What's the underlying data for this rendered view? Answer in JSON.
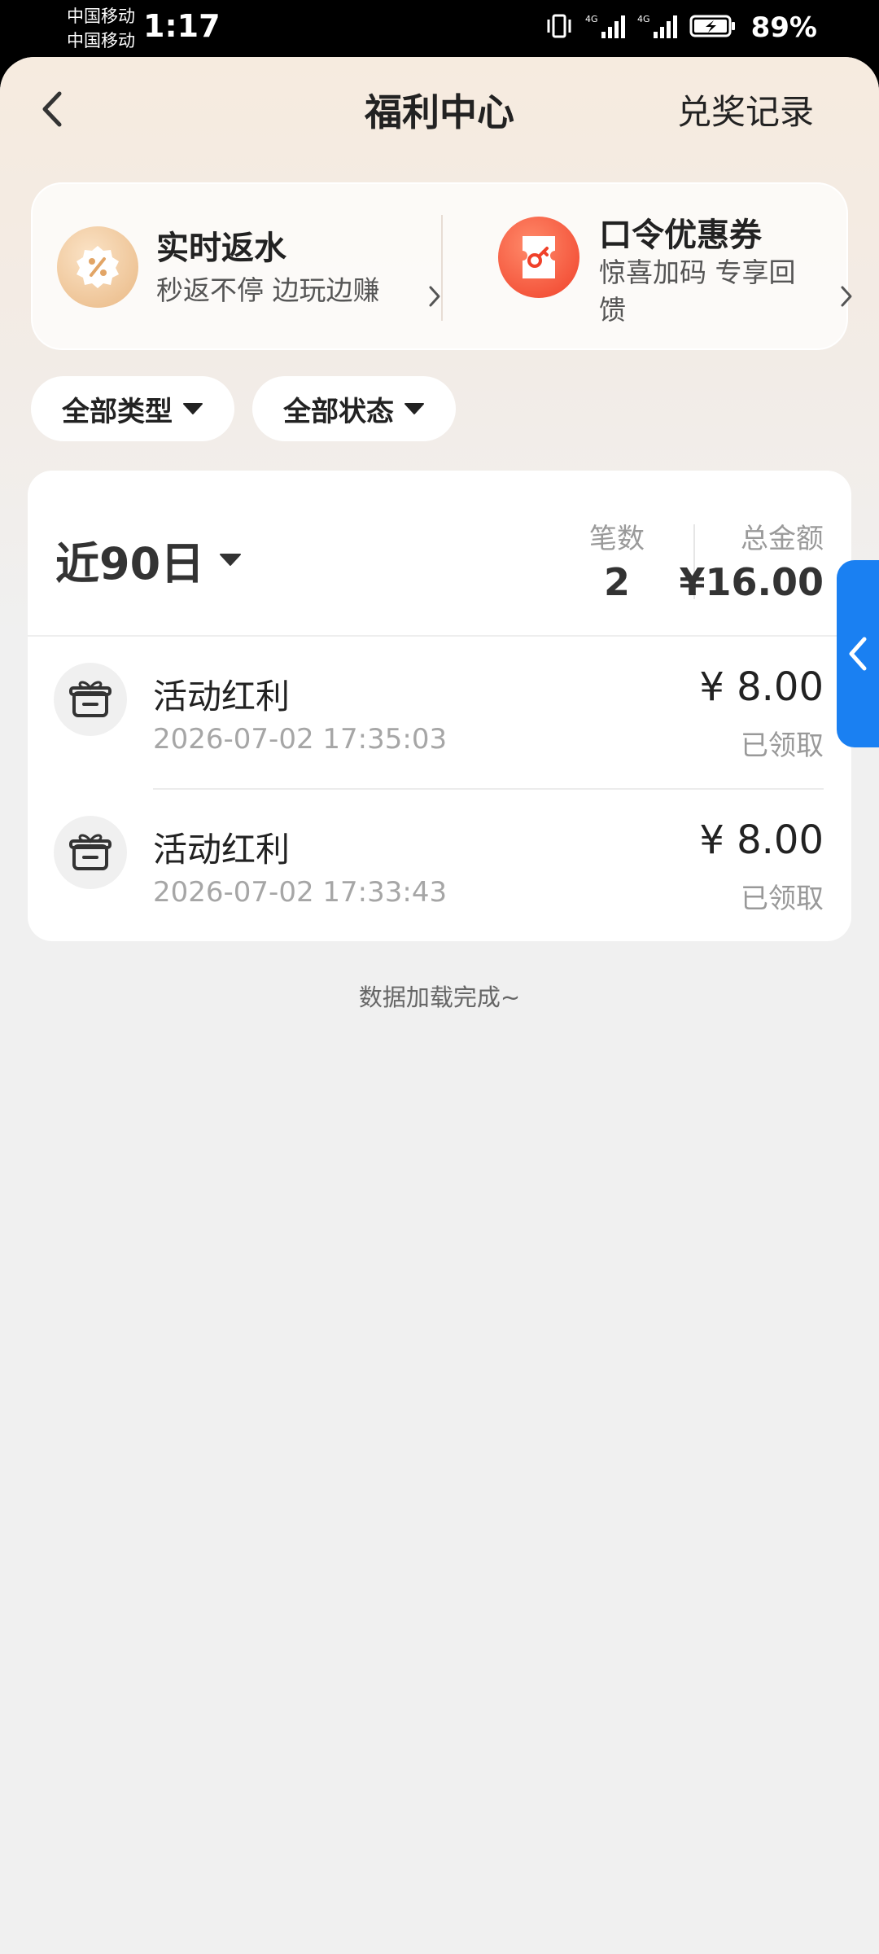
{
  "status_bar": {
    "carrier_1": "中国移动",
    "carrier_2": "中国移动",
    "time": "1:17",
    "battery": "89%"
  },
  "nav": {
    "title": "福利中心",
    "records_link": "兑奖记录"
  },
  "promos": {
    "rebate": {
      "title": "实时返水",
      "subtitle": "秒返不停 边玩边赚"
    },
    "coupon": {
      "title": "口令优惠券",
      "subtitle": "惊喜加码 专享回馈"
    }
  },
  "filters": {
    "type": "全部类型",
    "status": "全部状态"
  },
  "summary": {
    "period": "近90日",
    "count_label": "笔数",
    "count_value": "2",
    "total_label": "总金额",
    "total_value": "¥16.00"
  },
  "records": [
    {
      "title": "活动红利",
      "time": "2026-07-02 17:35:03",
      "amount": "¥ 8.00",
      "status": "已领取"
    },
    {
      "title": "活动红利",
      "time": "2026-07-02 17:33:43",
      "amount": "¥ 8.00",
      "status": "已领取"
    }
  ],
  "footer": {
    "load_complete": "数据加载完成~"
  },
  "colors": {
    "accent_blue": "#1a80f2",
    "coupon_red": "#f0412a",
    "rebate_gold": "#e9b884"
  }
}
